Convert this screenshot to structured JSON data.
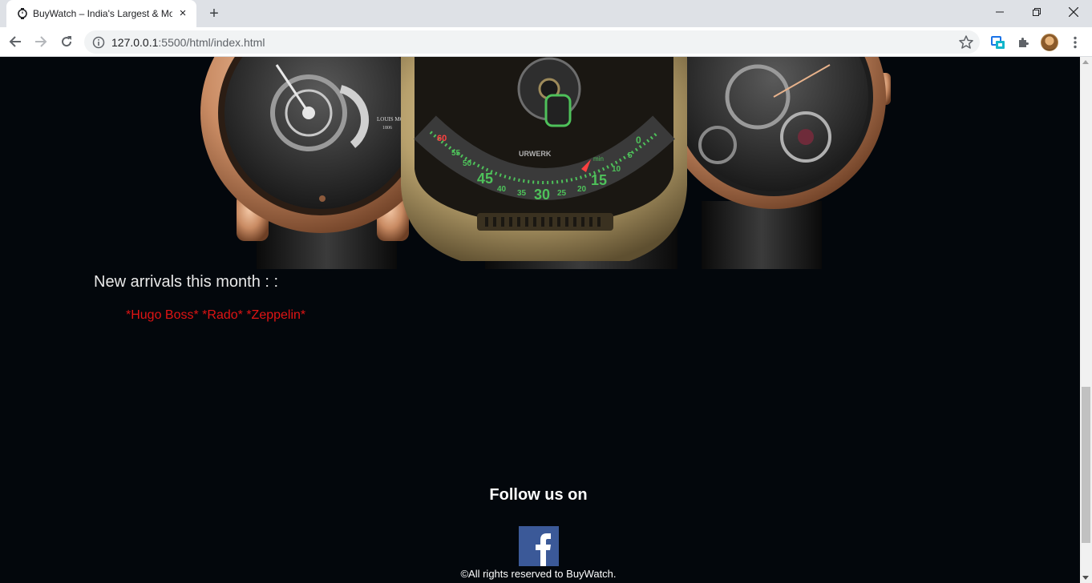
{
  "browser": {
    "tab_title": "BuyWatch – India's Largest & Mo",
    "tab_close_glyph": "×",
    "new_tab_glyph": "+",
    "url_host": "127.0.0.1",
    "url_path": ":5500/html/index.html"
  },
  "page": {
    "arrivals_heading": "New arrivals this month : :",
    "arrivals_brands": "*Hugo Boss* *Rado* *Zeppelin*",
    "follow_heading": "Follow us on",
    "copyright": "©All rights reserved to BuyWatch.",
    "brand_color": "#e01414",
    "facebook_color": "#3b5998"
  },
  "watch_dial": {
    "numerals": [
      "60",
      "55",
      "50",
      "45",
      "40",
      "35",
      "30",
      "25",
      "20",
      "15",
      "10",
      "5",
      "0"
    ],
    "minute_label": "min",
    "brand_left": "LOUIS MOINET",
    "year_left": "1806",
    "brand_center": "URWERK"
  }
}
